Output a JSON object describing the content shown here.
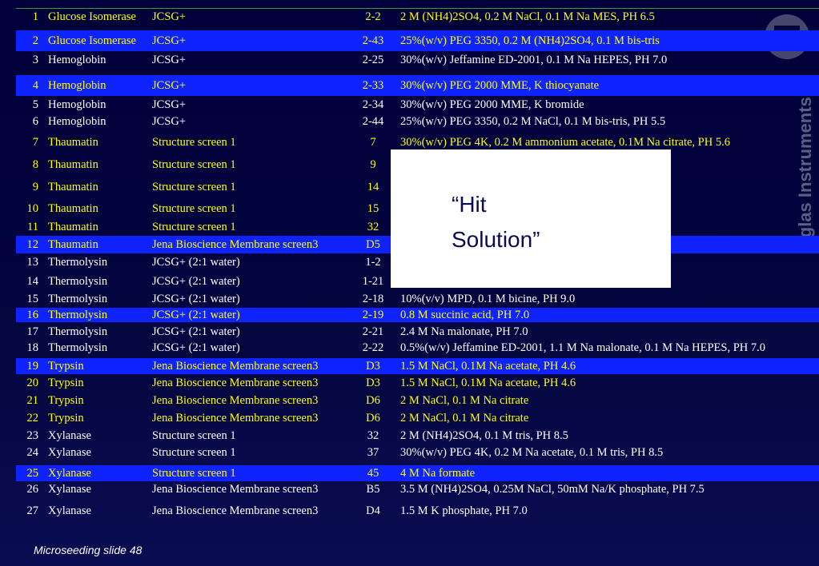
{
  "watermark": {
    "text": "Douglas Instruments"
  },
  "callout": {
    "line1": "“Hit",
    "line2": "Solution”"
  },
  "footer": {
    "text": "Microseeding slide 48"
  },
  "rows": [
    {
      "num": "1",
      "protein": "Glucose Isomerase",
      "screen": "JCSG+",
      "well": "2-2",
      "condition": "2 M  (NH4)2SO4, 0.2 M NaCl, 0.1 M Na MES, PH 6.5"
    },
    {
      "num": "2",
      "protein": "Glucose Isomerase",
      "screen": "JCSG+",
      "well": "2-43",
      "condition": "25%(w/v) PEG 3350, 0.2 M (NH4)2SO4, 0.1 M bis-tris"
    },
    {
      "num": "3",
      "protein": "Hemoglobin",
      "screen": "JCSG+",
      "well": "2-25",
      "condition": "30%(w/v) Jeffamine ED-2001, 0.1 M Na HEPES, PH 7.0"
    },
    {
      "num": "4",
      "protein": "Hemoglobin",
      "screen": "JCSG+",
      "well": "2-33",
      "condition": "30%(w/v) PEG 2000 MME, K thiocyanate"
    },
    {
      "num": "5",
      "protein": "Hemoglobin",
      "screen": "JCSG+",
      "well": "2-34",
      "condition": "30%(w/v) PEG 2000 MME, K bromide"
    },
    {
      "num": "6",
      "protein": "Hemoglobin",
      "screen": "JCSG+",
      "well": "2-44",
      "condition": "25%(w/v) PEG 3350, 0.2 M NaCl, 0.1 M bis-tris, PH 5.5"
    },
    {
      "num": "7",
      "protein": "Thaumatin",
      "screen": "Structure screen 1",
      "well": "7",
      "condition": "30%(w/v) PEG 4K, 0.2 M  ammonium acetate, 0.1M Na citrate, PH 5.6"
    },
    {
      "num": "8",
      "protein": "Thaumatin",
      "screen": "Structure screen 1",
      "well": "9",
      "condition": "H 5.6"
    },
    {
      "num": "9",
      "protein": "Thaumatin",
      "screen": "Structure screen 1",
      "well": "14",
      "condition": "odylate, PH 6.5"
    },
    {
      "num": "10",
      "protein": "Thaumatin",
      "screen": "Structure screen 1",
      "well": "15",
      "condition": "Na cacodylate, PH6.5"
    },
    {
      "num": "11",
      "protein": "Thaumatin",
      "screen": "Structure screen 1",
      "well": "32",
      "condition": ""
    },
    {
      "num": "12",
      "protein": "Thaumatin",
      "screen": "Jena Bioscience Membrane screen3",
      "well": "D5",
      "condition": ""
    },
    {
      "num": "13",
      "protein": "Thermolysin",
      "screen": "JCSG+ (2:1 water)",
      "well": "1-2",
      "condition": ""
    },
    {
      "num": "14",
      "protein": "Thermolysin",
      "screen": "JCSG+ (2:1 water)",
      "well": "1-21",
      "condition": ""
    },
    {
      "num": "15",
      "protein": "Thermolysin",
      "screen": "JCSG+ (2:1 water)",
      "well": "2-18",
      "condition": "10%(v/v) MPD,  0.1 M bicine, PH 9.0"
    },
    {
      "num": "16",
      "protein": "Thermolysin",
      "screen": "JCSG+ (2:1 water)",
      "well": "2-19",
      "condition": "0.8 M succinic acid, PH 7.0"
    },
    {
      "num": "17",
      "protein": "Thermolysin",
      "screen": "JCSG+ (2:1 water)",
      "well": "2-21",
      "condition": "2.4 M Na malonate, PH 7.0"
    },
    {
      "num": "18",
      "protein": "Thermolysin",
      "screen": "JCSG+ (2:1 water)",
      "well": "2-22",
      "condition": "0.5%(w/v) Jeffamine ED-2001, 1.1 M Na malonate, 0.1 M Na HEPES, PH 7.0"
    },
    {
      "num": "19",
      "protein": "Trypsin",
      "screen": "Jena Bioscience Membrane screen3",
      "well": "D3",
      "condition": "1.5 M NaCl, 0.1M Na acetate, PH 4.6"
    },
    {
      "num": "20",
      "protein": "Trypsin",
      "screen": "Jena Bioscience Membrane screen3",
      "well": "D3",
      "condition": "1.5 M NaCl, 0.1M Na acetate, PH 4.6"
    },
    {
      "num": "21",
      "protein": "Trypsin",
      "screen": "Jena Bioscience Membrane screen3",
      "well": "D6",
      "condition": "2 M NaCl, 0.1 M Na citrate"
    },
    {
      "num": "22",
      "protein": "Trypsin",
      "screen": "Jena Bioscience Membrane screen3",
      "well": "D6",
      "condition": "2 M NaCl, 0.1 M Na citrate"
    },
    {
      "num": "23",
      "protein": "Xylanase",
      "screen": "Structure screen 1",
      "well": "32",
      "condition": "2 M  (NH4)2SO4, 0.1 M tris, PH 8.5"
    },
    {
      "num": "24",
      "protein": "Xylanase",
      "screen": "Structure screen 1",
      "well": "37",
      "condition": "30%(w/v) PEG 4K, 0.2 M Na acetate, 0.1 M tris, PH 8.5"
    },
    {
      "num": "25",
      "protein": "Xylanase",
      "screen": "Structure screen 1",
      "well": "45",
      "condition": "4 M Na formate"
    },
    {
      "num": "26",
      "protein": "Xylanase",
      "screen": "Jena Bioscience Membrane screen3",
      "well": "B5",
      "condition": "3.5 M (NH4)2SO4, 0.25M NaCl, 50mM Na/K phosphate, PH 7.5"
    },
    {
      "num": "27",
      "protein": "Xylanase",
      "screen": "Jena Bioscience Membrane screen3",
      "well": "D4",
      "condition": "1.5 M K phosphate, PH 7.0"
    }
  ],
  "colors": {
    "highlight_row": "#0f23ff",
    "yellow_text": "#ffff00",
    "white_text": "#ffffff",
    "background": "#00003a"
  }
}
